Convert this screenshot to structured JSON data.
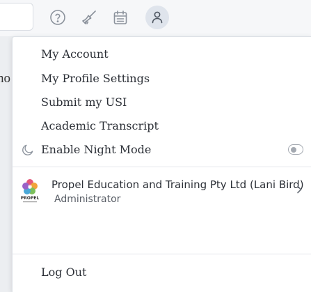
{
  "topbar": {
    "icons": [
      "help-circle-icon",
      "broom-icon",
      "calendar-icon",
      "user-account-icon"
    ]
  },
  "background": {
    "partial_text": "no"
  },
  "menu": {
    "items": [
      {
        "label": "My Account"
      },
      {
        "label": "My Profile Settings"
      },
      {
        "label": "Submit my USI"
      },
      {
        "label": "Academic Transcript"
      }
    ],
    "night_mode": {
      "label": "Enable Night Mode",
      "enabled": false
    },
    "organisation": {
      "name": "Propel Education and Training Pty Ltd (Lani Bird)",
      "role": "Administrator",
      "logo_text": "PROPEL"
    },
    "logout_label": "Log Out"
  },
  "colors": {
    "text": "#2b2f36",
    "muted": "#5a5f67",
    "icon": "#8b929c",
    "active_icon_bg": "#dfe4ec"
  }
}
